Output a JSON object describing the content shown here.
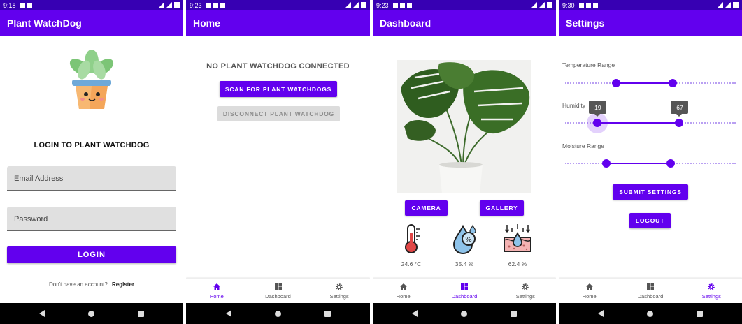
{
  "theme": {
    "primary": "#6200ee",
    "primary_dark": "#3700b3",
    "disabled": "#dcdcdc",
    "accent_text": "#6200ee"
  },
  "screen1": {
    "time": "9:18",
    "appbar_title": "Plant WatchDog",
    "login_title": "LOGIN TO PLANT WATCHDOG",
    "email_placeholder": "Email Address",
    "password_placeholder": "Password",
    "login_button": "LOGIN",
    "register_prompt": "Don't have an account?",
    "register_link": "Register"
  },
  "screen2": {
    "time": "9:23",
    "appbar_title": "Home",
    "status_text": "NO PLANT WATCHDOG CONNECTED",
    "scan_button": "SCAN FOR PLANT WATCHDOGS",
    "disconnect_button": "DISCONNECT PLANT WATCHDOG"
  },
  "screen3": {
    "time": "9:23",
    "appbar_title": "Dashboard",
    "camera_button": "CAMERA",
    "gallery_button": "GALLERY",
    "sensors": [
      {
        "icon": "thermometer-icon",
        "value": "24.6 °C"
      },
      {
        "icon": "humidity-drop-icon",
        "value": "35.4 %"
      },
      {
        "icon": "soil-moisture-icon",
        "value": "62.4 %"
      }
    ]
  },
  "screen4": {
    "time": "9:30",
    "appbar_title": "Settings",
    "temperature_label": "Temperature Range",
    "humidity_label": "Humidity",
    "moisture_label": "Moisture Range",
    "temperature_range": [
      0.3,
      0.63
    ],
    "humidity_range": [
      0.19,
      0.67
    ],
    "humidity_tooltips": [
      "19",
      "67"
    ],
    "moisture_range": [
      0.24,
      0.62
    ],
    "submit_button": "SUBMIT SETTINGS",
    "logout_button": "LOGOUT"
  },
  "bottom_nav": {
    "home": "Home",
    "dashboard": "Dashboard",
    "settings": "Settings"
  }
}
